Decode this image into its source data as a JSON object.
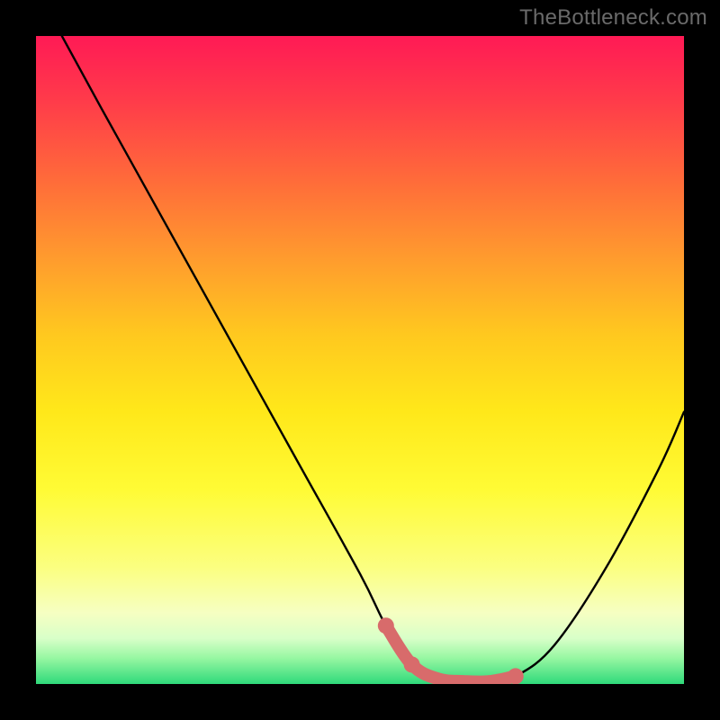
{
  "watermark": {
    "text": "TheBottleneck.com"
  },
  "colors": {
    "frame": "#000000",
    "curve": "#000000",
    "flat_stroke": "#d86b6b",
    "gradient_top": "#ff1a55",
    "gradient_bottom": "#2fd97a"
  },
  "chart_data": {
    "type": "line",
    "title": "",
    "xlabel": "",
    "ylabel": "",
    "xlim": [
      0,
      100
    ],
    "ylim": [
      0,
      100
    ],
    "grid": false,
    "legend": false,
    "series": [
      {
        "name": "bottleneck-curve",
        "x": [
          4,
          10,
          20,
          30,
          40,
          50,
          54,
          58,
          62,
          66,
          70,
          74,
          80,
          88,
          96,
          100
        ],
        "y": [
          100,
          89,
          71,
          53,
          35,
          17,
          9,
          3,
          0.8,
          0.4,
          0.4,
          1.2,
          6,
          18,
          33,
          42
        ]
      },
      {
        "name": "flat-zone-highlight",
        "x": [
          54,
          58,
          62,
          66,
          70,
          74
        ],
        "y": [
          9,
          3,
          0.8,
          0.4,
          0.4,
          1.2
        ]
      }
    ],
    "annotations": [
      {
        "text": "TheBottleneck.com",
        "position": "top-right"
      }
    ]
  }
}
